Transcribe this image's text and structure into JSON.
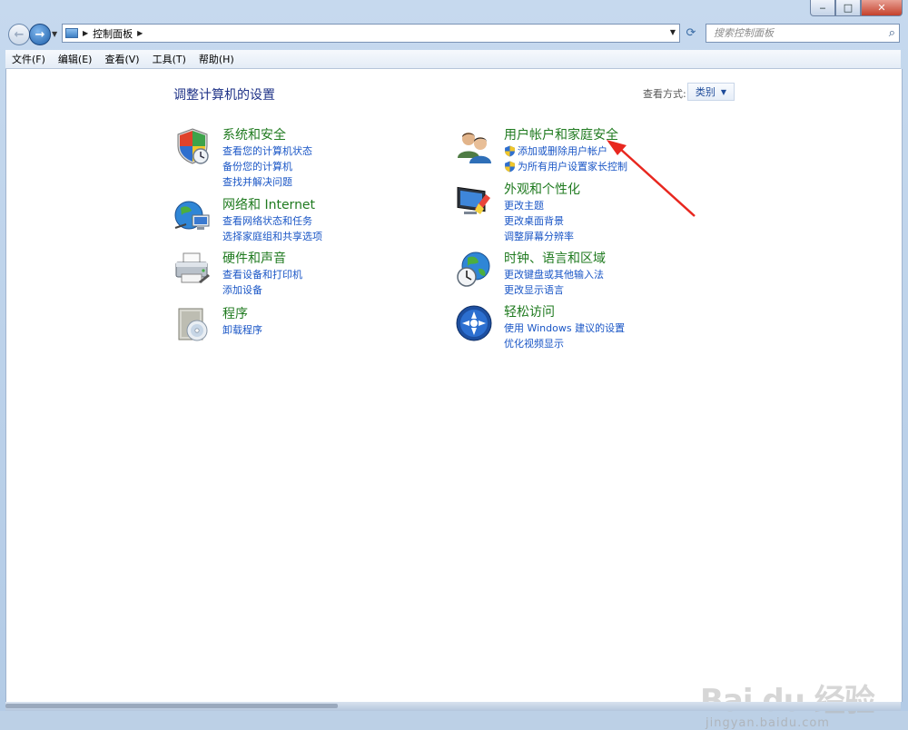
{
  "window": {
    "caption": {
      "minimize": "‒",
      "maximize": "□",
      "close": "✕"
    }
  },
  "nav": {
    "back": "←",
    "forward": "→",
    "address_path": "控制面板",
    "search_placeholder": "搜索控制面板"
  },
  "menu": [
    {
      "label": "文件(F)"
    },
    {
      "label": "编辑(E)"
    },
    {
      "label": "查看(V)"
    },
    {
      "label": "工具(T)"
    },
    {
      "label": "帮助(H)"
    }
  ],
  "page": {
    "title": "调整计算机的设置",
    "view_by_label": "查看方式:",
    "view_by_value": "类别"
  },
  "categories_left": [
    {
      "title": "系统和安全",
      "icon": "shield-icon",
      "links": [
        "查看您的计算机状态",
        "备份您的计算机",
        "查找并解决问题"
      ]
    },
    {
      "title": "网络和 Internet",
      "icon": "globe-network-icon",
      "links": [
        "查看网络状态和任务",
        "选择家庭组和共享选项"
      ]
    },
    {
      "title": "硬件和声音",
      "icon": "printer-icon",
      "links": [
        "查看设备和打印机",
        "添加设备"
      ]
    },
    {
      "title": "程序",
      "icon": "programs-icon",
      "links": [
        "卸载程序"
      ]
    }
  ],
  "categories_right": [
    {
      "title": "用户帐户和家庭安全",
      "icon": "users-icon",
      "links": [
        "添加或删除用户帐户",
        "为所有用户设置家长控制"
      ]
    },
    {
      "title": "外观和个性化",
      "icon": "monitor-paint-icon",
      "links": [
        "更改主题",
        "更改桌面背景",
        "调整屏幕分辨率"
      ]
    },
    {
      "title": "时钟、语言和区域",
      "icon": "globe-clock-icon",
      "links": [
        "更改键盘或其他输入法",
        "更改显示语言"
      ]
    },
    {
      "title": "轻松访问",
      "icon": "ease-of-access-icon",
      "links": [
        "使用 Windows 建议的设置",
        "优化视频显示"
      ]
    }
  ],
  "colors": {
    "title_blue": "#1e3287",
    "category_green": "#1f7a1f",
    "link_blue": "#1a56c6",
    "annotation_red": "#e8271f"
  },
  "watermark": {
    "logo": "Bai du 经验",
    "url": "jingyan.baidu.com"
  }
}
